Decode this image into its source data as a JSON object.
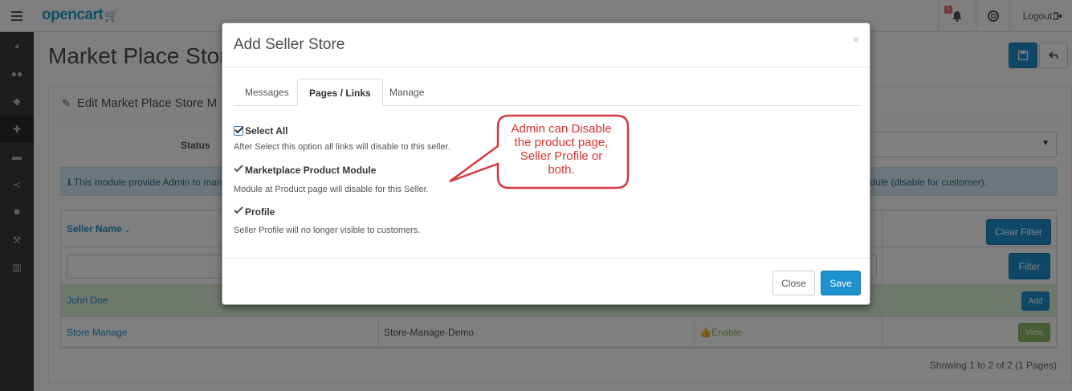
{
  "header": {
    "logo": "opencart",
    "notification_count": "1",
    "logout_label": "Logout"
  },
  "sidebar": {
    "icons": [
      "dashboard-icon",
      "users-icon",
      "tags-icon",
      "puzzle-icon",
      "cart-icon",
      "share-icon",
      "cog-icon",
      "wrench-icon",
      "chart-icon"
    ]
  },
  "page": {
    "title": "Market Place Stor",
    "panel_title": "Edit Market Place Store M",
    "status_label": "Status",
    "alert_text": "This module provide Admin to mana",
    "alert_text_right": "odule (disable for customer).",
    "table": {
      "seller_name_header": "Seller Name",
      "clear_filter_label": "Clear Filter",
      "filter_label": "Filter",
      "rows": [
        {
          "name": "John Doe",
          "action": "Add"
        },
        {
          "name": "Store Manage",
          "store": "Store-Manage-Demo",
          "status": "Enable",
          "action": "View"
        }
      ]
    },
    "pagination": "Showing 1 to 2 of 2 (1 Pages)"
  },
  "modal": {
    "title": "Add Seller Store",
    "close_symbol": "×",
    "tabs": [
      {
        "label": "Messages",
        "active": false
      },
      {
        "label": "Pages / Links",
        "active": true
      },
      {
        "label": "Manage",
        "active": false
      }
    ],
    "options": [
      {
        "label": "Select All",
        "help": "After Select this option all links will disable to this seller.",
        "checked": true
      },
      {
        "label": "Marketplace Product Module",
        "help": "Module at Product page will disable for this Seller.",
        "checked": true
      },
      {
        "label": "Profile",
        "help": "Seller Profile will no longer visible to customers.",
        "checked": true
      }
    ],
    "close_label": "Close",
    "save_label": "Save"
  },
  "callout": {
    "lines": [
      "Admin can Disable",
      "the product page,",
      "Seller Profile or",
      "both."
    ]
  },
  "colors": {
    "primary": "#1e91cf",
    "success": "#8fbb6c",
    "callout_red": "#e03030"
  }
}
